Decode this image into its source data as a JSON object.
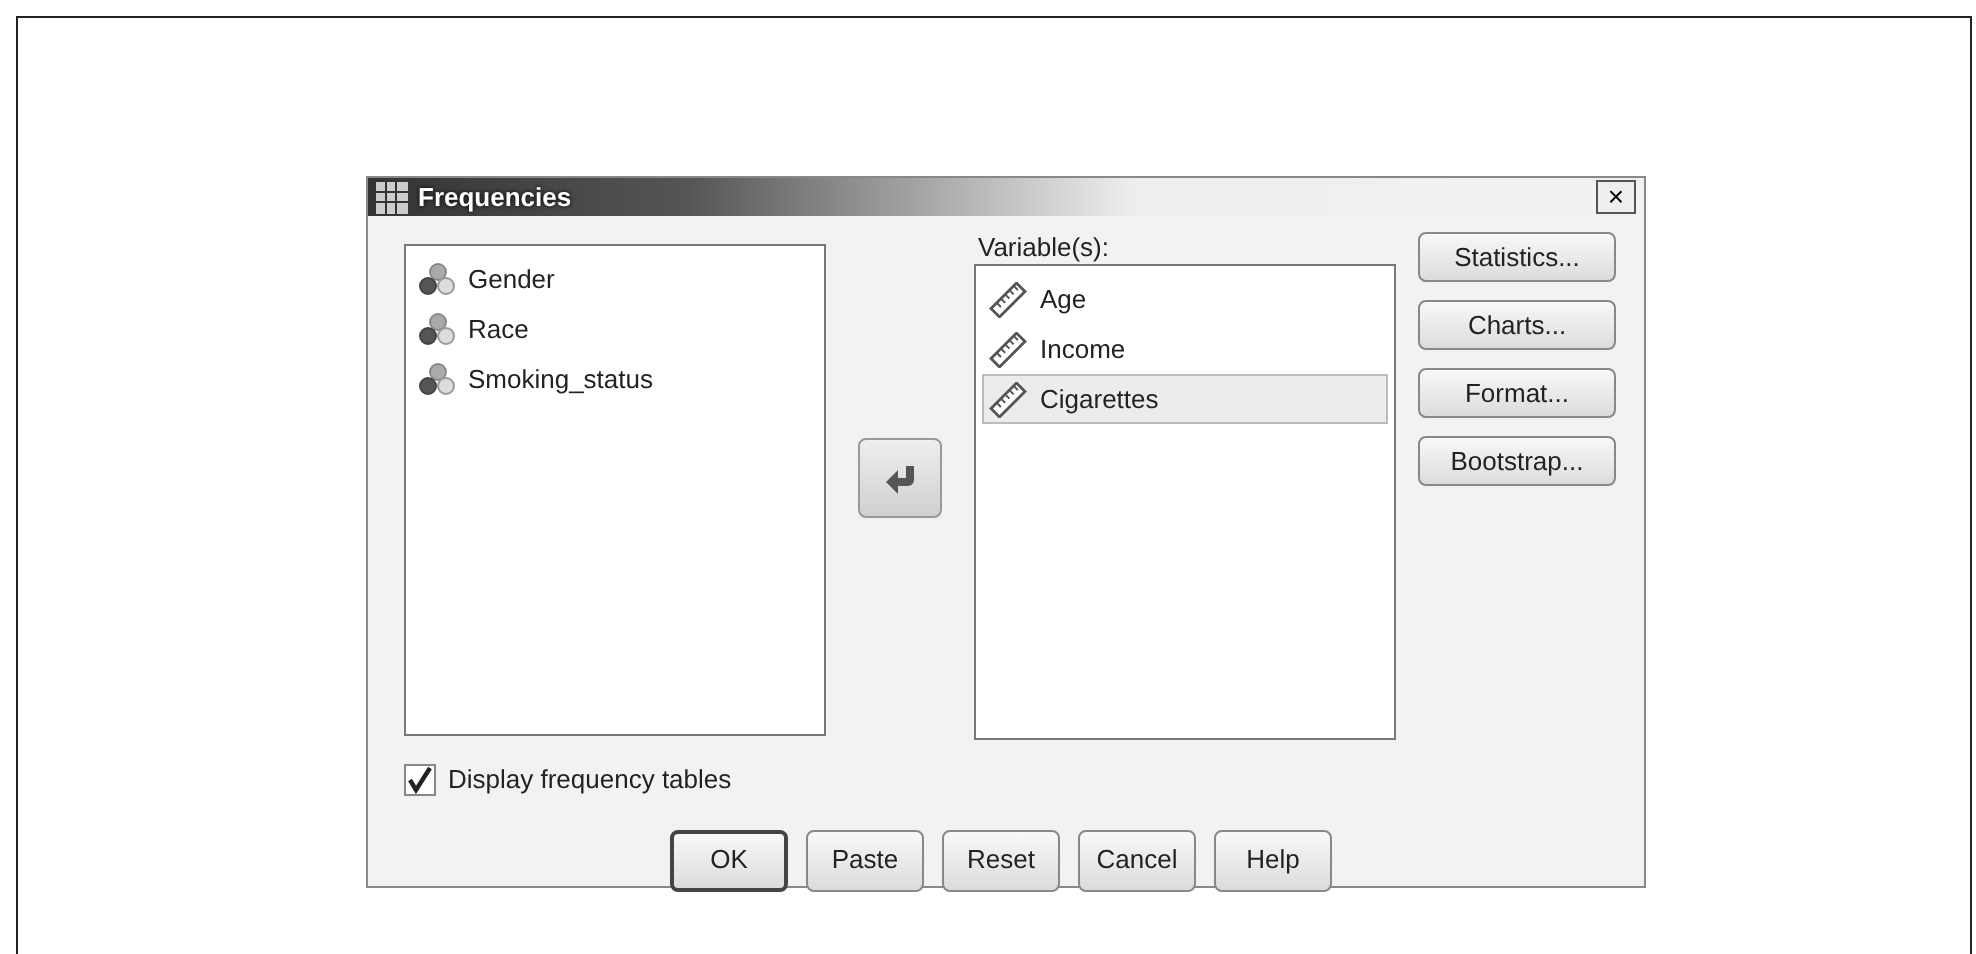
{
  "window": {
    "title": "Frequencies",
    "close": "×"
  },
  "source_list": {
    "items": [
      {
        "label": "Gender",
        "kind": "nominal"
      },
      {
        "label": "Race",
        "kind": "nominal"
      },
      {
        "label": "Smoking_status",
        "kind": "nominal"
      }
    ]
  },
  "target_list": {
    "label": "Variable(s):",
    "items": [
      {
        "label": "Age",
        "kind": "scale",
        "selected": false
      },
      {
        "label": "Income",
        "kind": "scale",
        "selected": false
      },
      {
        "label": "Cigarettes",
        "kind": "scale",
        "selected": true
      }
    ]
  },
  "side_buttons": [
    "Statistics...",
    "Charts...",
    "Format...",
    "Bootstrap..."
  ],
  "checkbox": {
    "label": "Display frequency tables",
    "checked": true
  },
  "buttons": [
    {
      "label": "OK",
      "default": true
    },
    {
      "label": "Paste",
      "default": false
    },
    {
      "label": "Reset",
      "default": false
    },
    {
      "label": "Cancel",
      "default": false
    },
    {
      "label": "Help",
      "default": false
    }
  ]
}
